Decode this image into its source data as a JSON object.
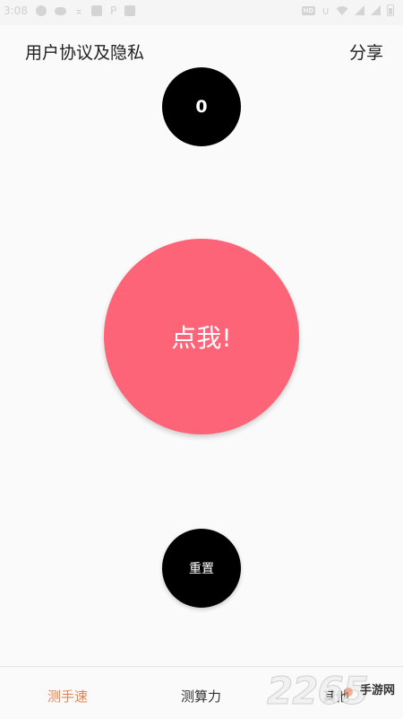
{
  "status_bar": {
    "time": "3:08",
    "network_badge": "HD"
  },
  "header": {
    "left_link": "用户协议及隐私",
    "share": "分享"
  },
  "counter": {
    "value": "0"
  },
  "tap_button": {
    "label": "点我!"
  },
  "reset_button": {
    "label": "重置"
  },
  "bottom_nav": {
    "tabs": [
      {
        "label": "测手速",
        "active": true
      },
      {
        "label": "测算力",
        "active": false
      },
      {
        "label": "其他",
        "active": false
      }
    ]
  },
  "watermark": {
    "digits": "2265",
    "text": "手游网"
  },
  "colors": {
    "accent": "#fe6477",
    "active_tab": "#e2865e",
    "circle_dark": "#000000",
    "background": "#fafafa"
  }
}
